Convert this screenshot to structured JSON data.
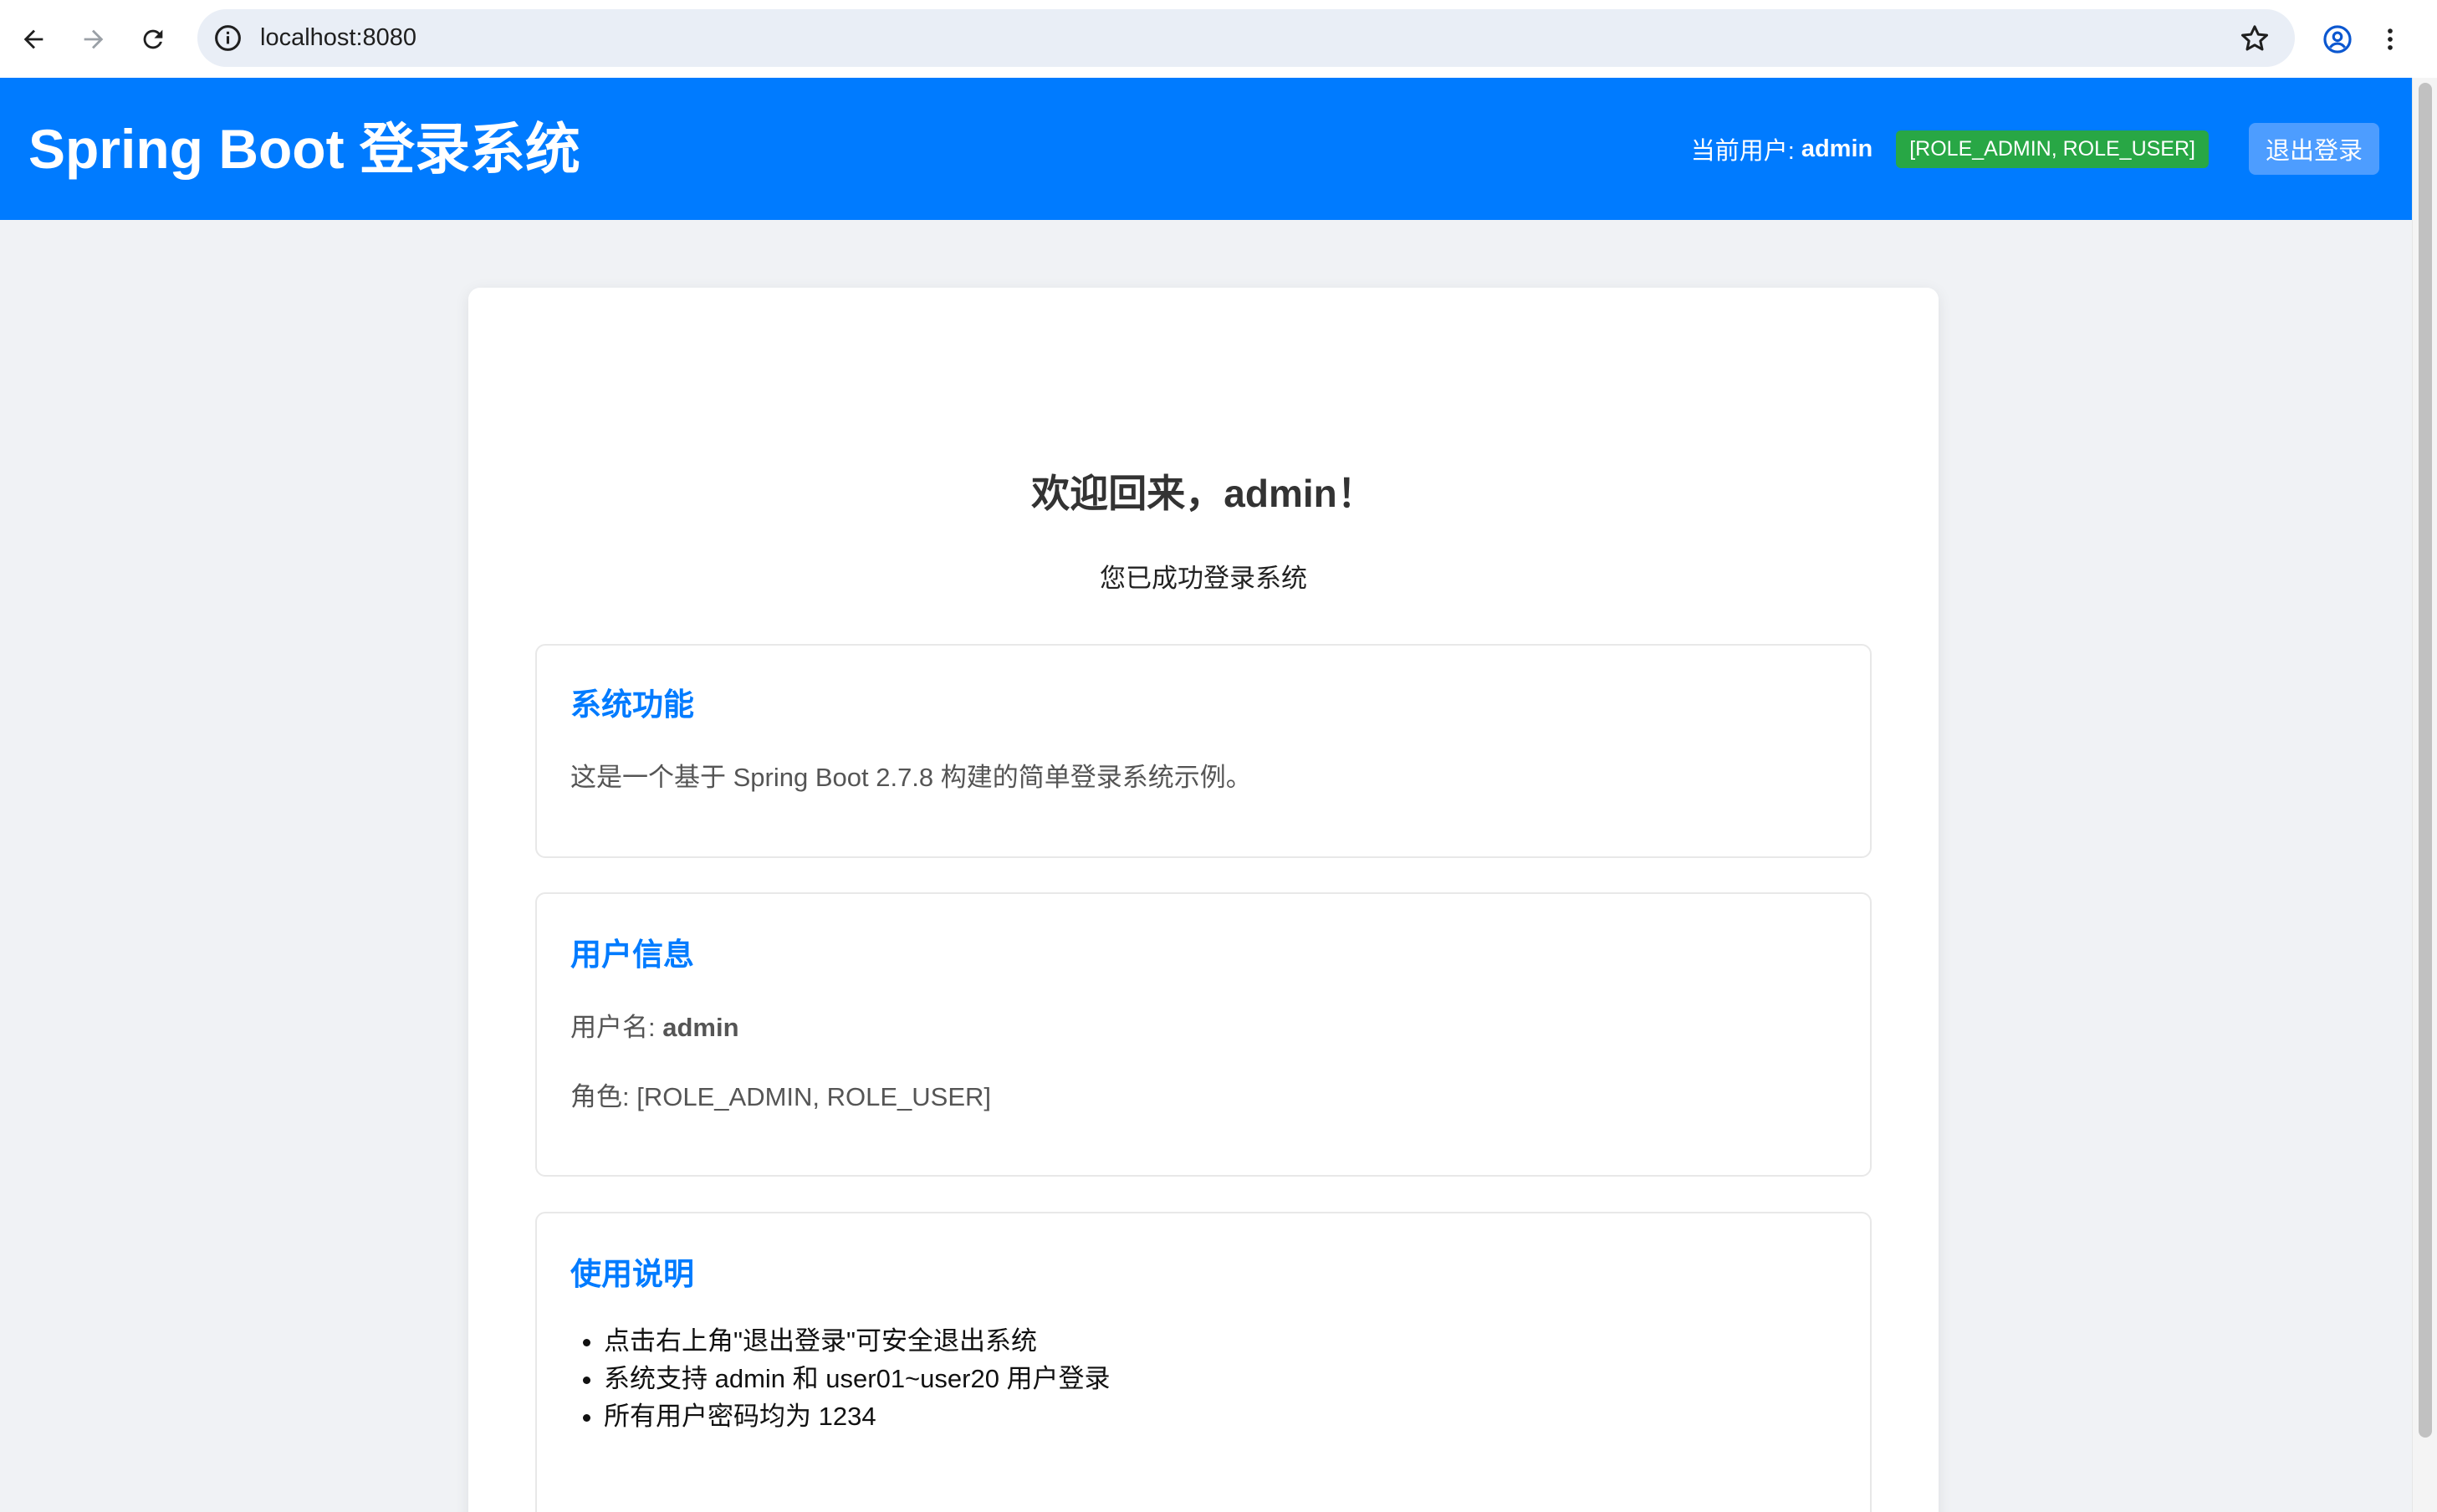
{
  "browser": {
    "url": "localhost:8080",
    "icons": [
      "back-arrow-icon",
      "forward-arrow-icon",
      "reload-icon",
      "info-icon",
      "star-icon",
      "profile-icon",
      "menu-dots-icon"
    ]
  },
  "header": {
    "title": "Spring Boot 登录系统",
    "current_user_label": "当前用户:",
    "current_user_name": "admin",
    "roles_badge": "[ROLE_ADMIN, ROLE_USER]",
    "logout_label": "退出登录"
  },
  "main": {
    "welcome_title": "欢迎回来，admin！",
    "welcome_subtitle": "您已成功登录系统",
    "system_features": {
      "title": "系统功能",
      "text": "这是一个基于 Spring Boot 2.7.8 构建的简单登录系统示例。"
    },
    "user_info": {
      "title": "用户信息",
      "username_label": "用户名:",
      "username_value": "admin",
      "role_label": "角色:",
      "role_value": "[ROLE_ADMIN, ROLE_USER]"
    },
    "usage": {
      "title": "使用说明",
      "items": [
        "点击右上角\"退出登录\"可安全退出系统",
        "系统支持 admin 和 user01~user20 用户登录",
        "所有用户密码均为 1234"
      ]
    }
  },
  "colors": {
    "primary": "#007bff",
    "badge_green": "#28a745",
    "page_bg": "#f0f2f5",
    "logout_button": "#4d9dff"
  }
}
